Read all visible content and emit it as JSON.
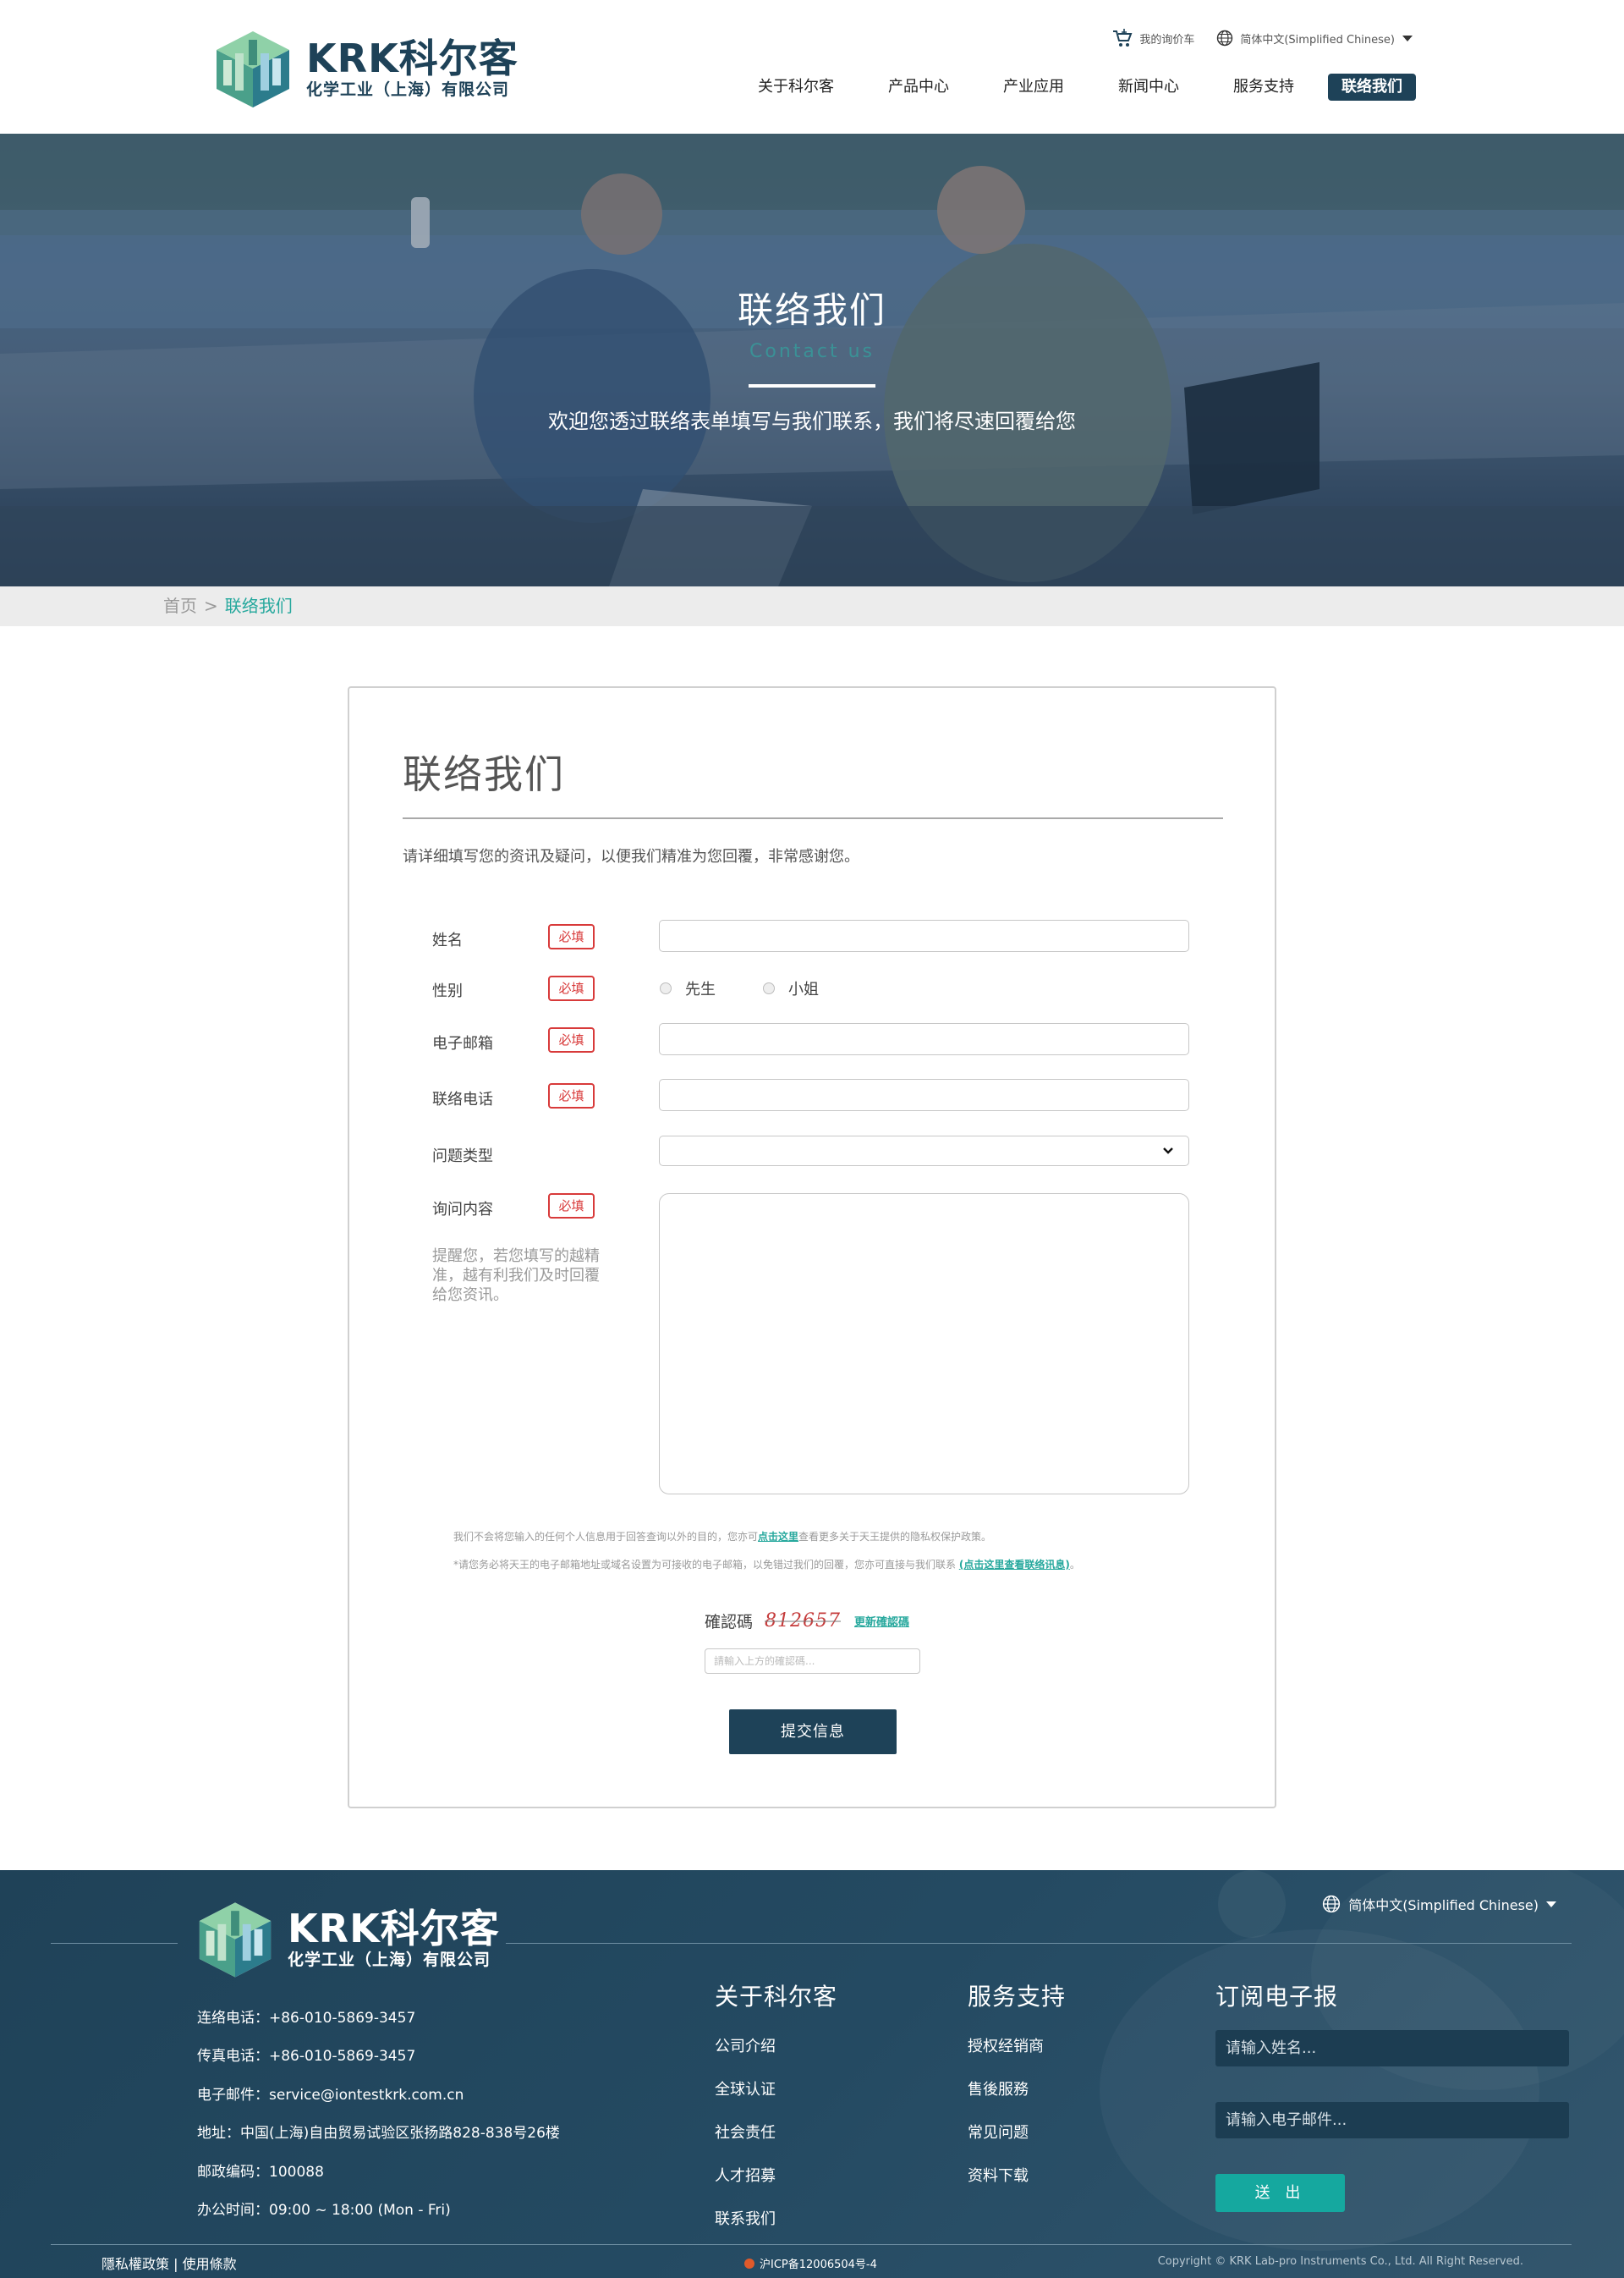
{
  "header": {
    "brand": "KRK科尔客",
    "brand_sub": "化学工业（上海）有限公司",
    "cart_label": "我的询价车",
    "language": "简体中文(Simplified Chinese)",
    "nav": [
      "关于科尔客",
      "产品中心",
      "产业应用",
      "新闻中心",
      "服务支持",
      "联络我们"
    ]
  },
  "banner": {
    "title": "联络我们",
    "subtitle": "Contact us",
    "description": "欢迎您透过联络表单填写与我们联系，我们将尽速回覆给您"
  },
  "breadcrumb": {
    "home": "首页",
    "separator": ">",
    "current": "联络我们"
  },
  "form": {
    "title": "联络我们",
    "intro": "请详细填写您的资讯及疑问，以便我们精准为您回覆，非常感谢您。",
    "required_label": "必填",
    "fields": {
      "name": "姓名",
      "gender": "性别",
      "gender_options": [
        "先生",
        "小姐"
      ],
      "email": "电子邮箱",
      "phone": "联络电话",
      "question_type": "问题类型",
      "inquiry": "询问内容"
    },
    "hint": "提醒您，若您填写的越精准，越有利我们及时回覆给您资讯。",
    "notice1_before": "我们不会将您输入的任何个人信息用于回答查询以外的目的，您亦可",
    "notice1_link": "点击这里",
    "notice1_after": "查看更多关于天王提供的隐私权保护政策。",
    "notice2_before": "*请您务必将天王的电子邮箱地址或域名设置为可接收的电子邮箱，以免错过我们的回覆，您亦可直接与我们联系 ",
    "notice2_link": "(点击这里查看联络讯息)",
    "notice2_after": "。",
    "captcha_label": "確認碼",
    "captcha_code": "812657",
    "captcha_refresh": "更新確認碼",
    "captcha_placeholder": "請輸入上方的確認碼...",
    "submit": "提交信息"
  },
  "footer": {
    "brand": "KRK科尔客",
    "brand_sub": "化学工业（上海）有限公司",
    "language": "简体中文(Simplified Chinese)",
    "contact": [
      "连络电话：+86-010-5869-3457",
      "传真电话：+86-010-5869-3457",
      "电子邮件：service@iontestkrk.com.cn",
      "地址：中国(上海)自由贸易试验区张扬路828-838号26楼",
      "邮政编码：100088",
      "办公时间：09:00 ~ 18:00 (Mon - Fri)"
    ],
    "about": {
      "title": "关于科尔客",
      "items": [
        "公司介绍",
        "全球认证",
        "社会责任",
        "人才招募",
        "联系我们"
      ]
    },
    "service": {
      "title": "服务支持",
      "items": [
        "授权经销商",
        "售後服務",
        "常见问题",
        "资料下载"
      ]
    },
    "newsletter": {
      "title": "订阅电子报",
      "name_placeholder": "请输入姓名...",
      "email_placeholder": "请输入电子邮件...",
      "submit": "送 出"
    },
    "bottom_links": "隱私權政策 | 使用條款",
    "icp": "沪ICP备12006504号-4",
    "copyright": "Copyright © KRK Lab-pro Instruments Co., Ltd. All Right Reserved."
  },
  "colors": {
    "brand_dark": "#1e4258",
    "accent_teal": "#26a89d",
    "required_red": "#d83a3a"
  }
}
